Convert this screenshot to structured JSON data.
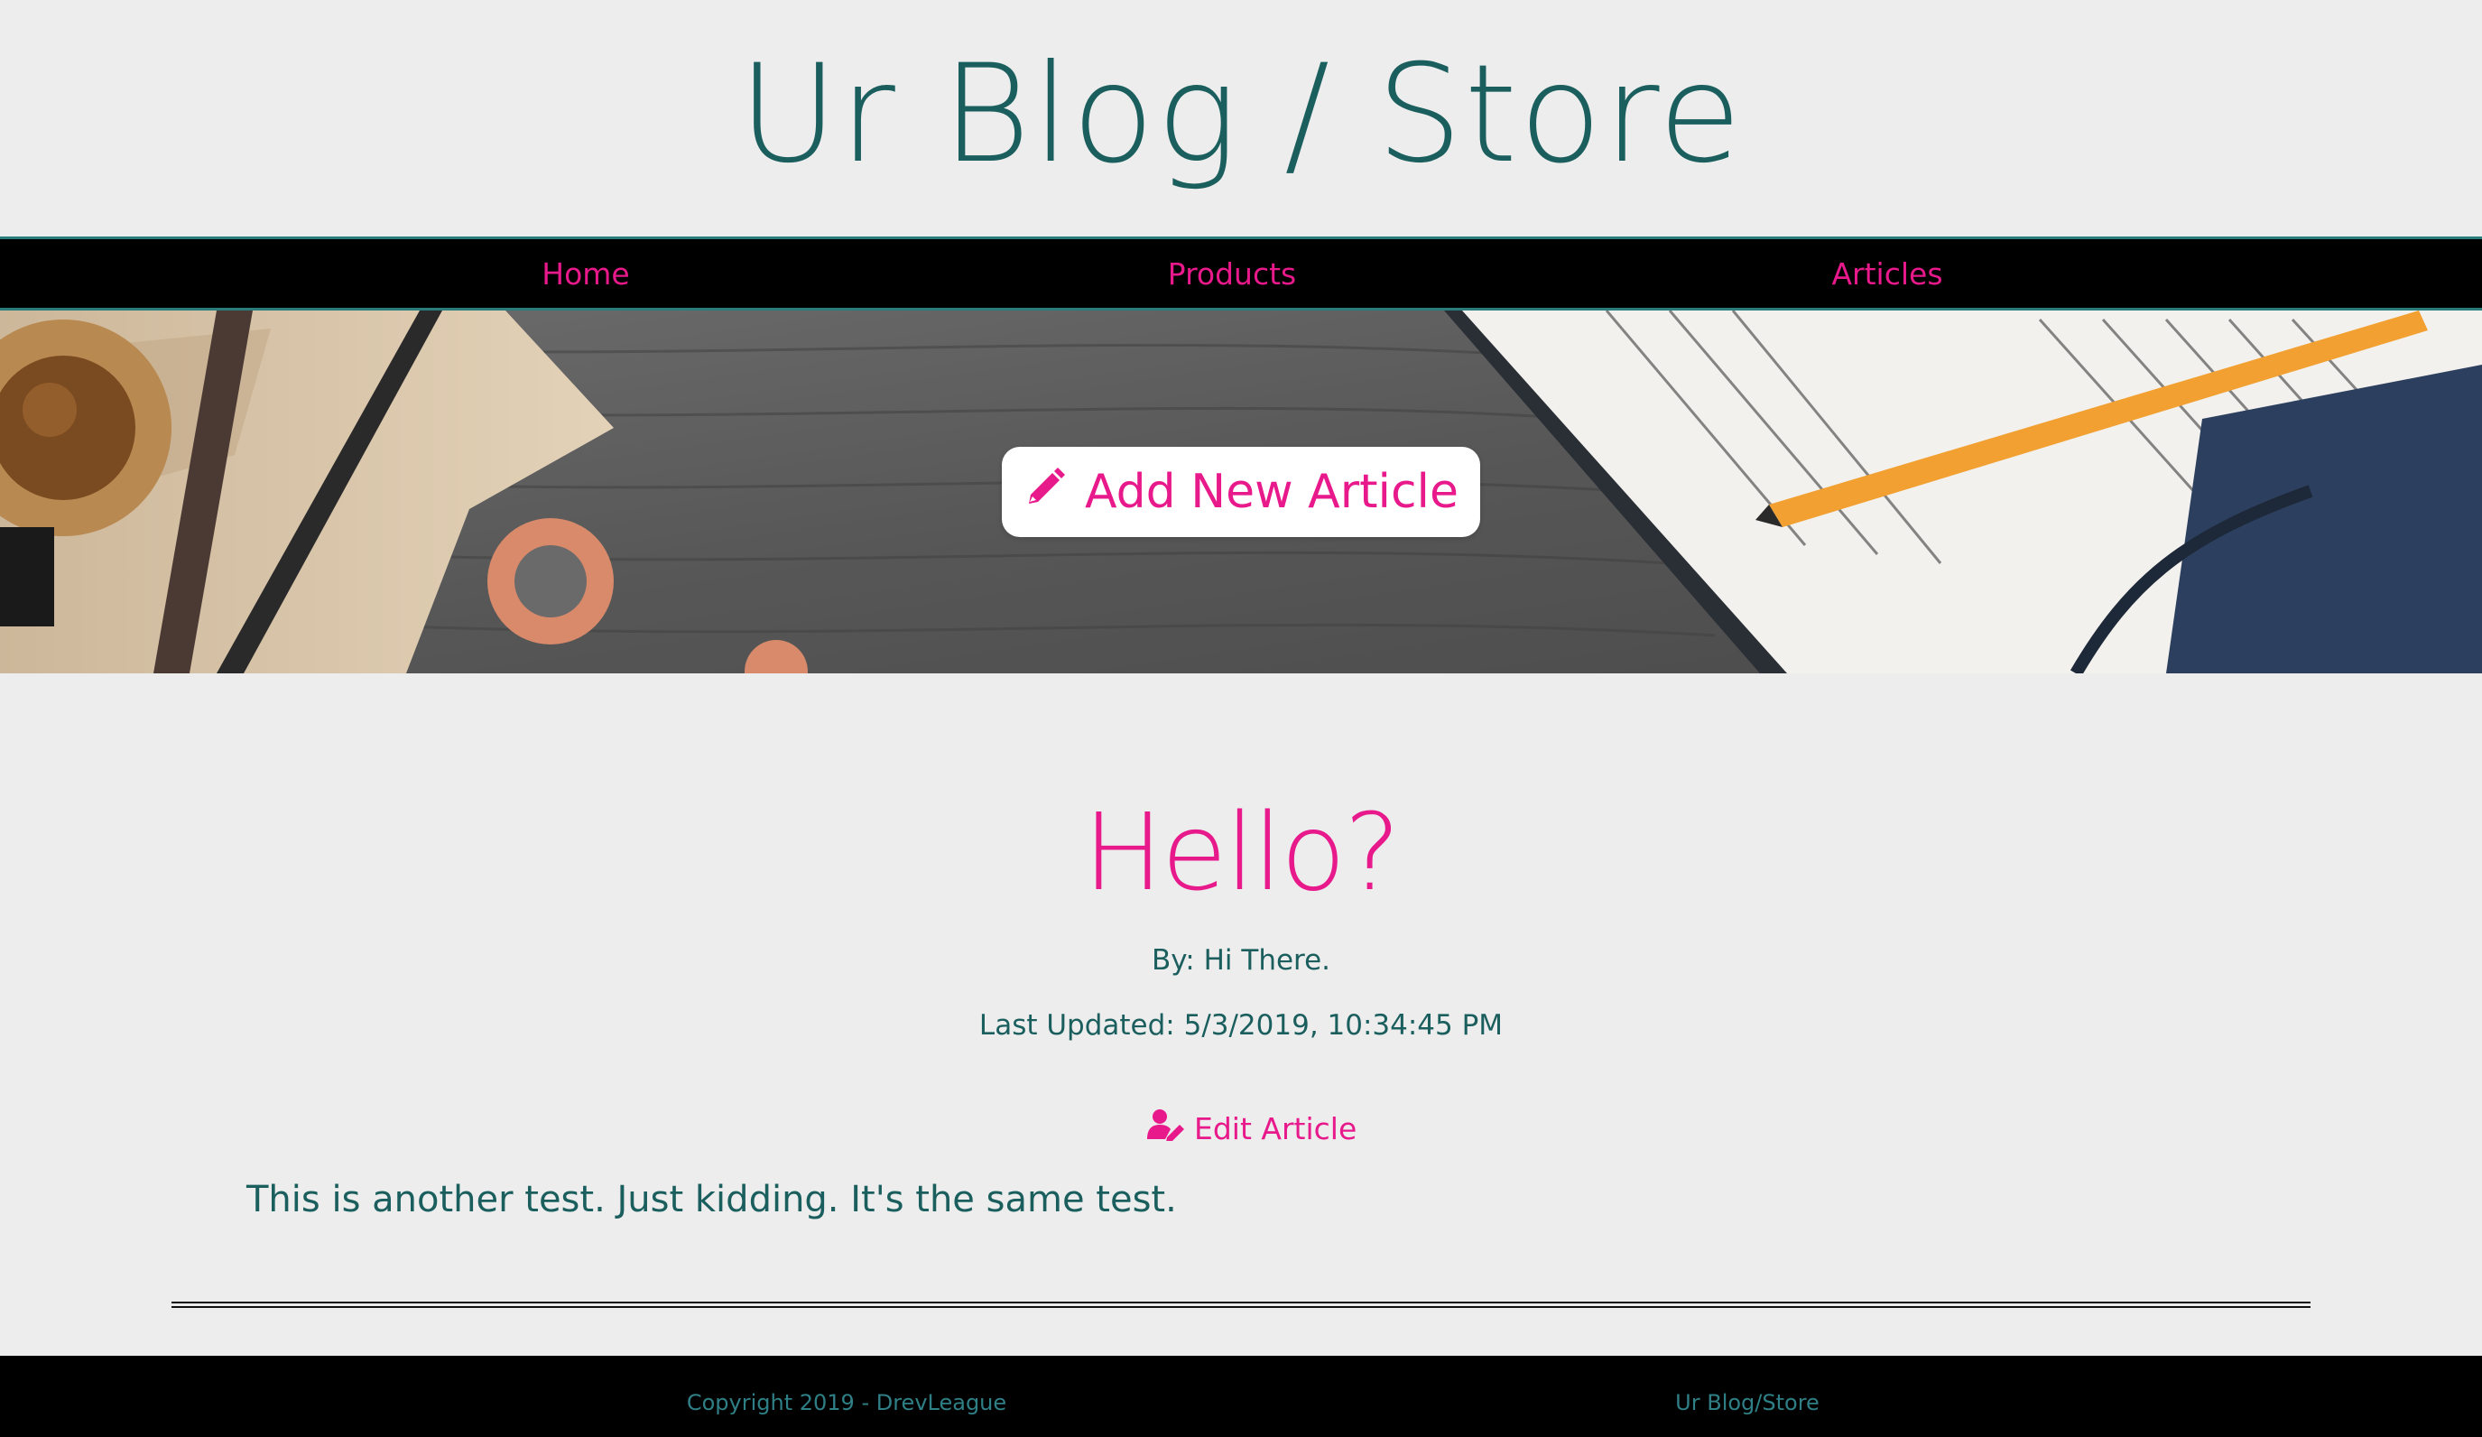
{
  "header": {
    "title": "Ur Blog / Store"
  },
  "nav": {
    "items": [
      {
        "label": "Home"
      },
      {
        "label": "Products"
      },
      {
        "label": "Articles"
      }
    ]
  },
  "hero": {
    "add_button_label": "Add New Article",
    "add_button_icon": "pencil-icon"
  },
  "article": {
    "title": "Hello?",
    "author": "By: Hi There.",
    "last_updated": "Last Updated: 5/3/2019, 10:34:45 PM",
    "edit_label": "Edit Article",
    "edit_icon": "user-edit-icon",
    "body": "This is another test. Just kidding. It's the same test."
  },
  "footer": {
    "copyright": "Copyright 2019 - DrevLeague",
    "brand": "Ur Blog/Store"
  },
  "colors": {
    "accent": "#e8198b",
    "text": "#1b5e5e",
    "background": "#ededed",
    "nav_bg": "#000000"
  }
}
